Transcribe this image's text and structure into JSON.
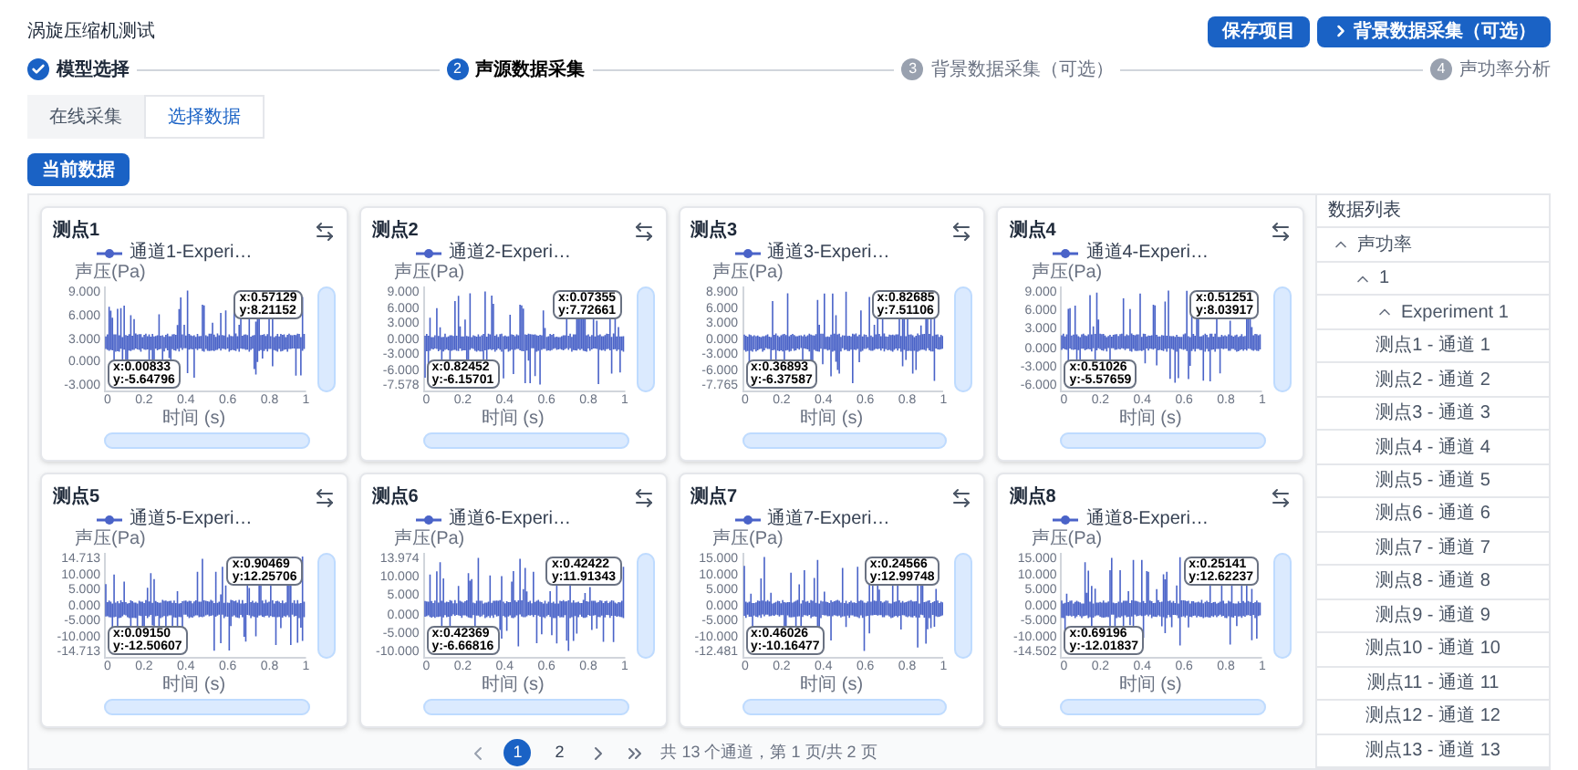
{
  "header": {
    "title": "涡旋压缩机测试",
    "buttons": [
      {
        "label": "保存项目",
        "kind": "plain"
      },
      {
        "label": "背景数据采集（可选）",
        "kind": "next"
      }
    ]
  },
  "steps": [
    {
      "label": "模型选择",
      "completed": true,
      "active": false
    },
    {
      "number": "2",
      "label": "声源数据采集",
      "completed": false,
      "active": true
    },
    {
      "number": "3",
      "label": "背景数据采集（可选）",
      "completed": false,
      "active": false
    },
    {
      "number": "4",
      "label": "声功率分析",
      "completed": false,
      "active": false
    }
  ],
  "zoom_sliders": {
    "vertical": {
      "level": 1
    },
    "horizontal": {
      "level": 1
    }
  },
  "tabs": [
    {
      "label": "在线采集",
      "selected": false
    },
    {
      "label": "选择数据",
      "selected": true
    }
  ],
  "current_data_button": "当前数据",
  "charts": [
    {
      "title": "测点1",
      "legend": "通道1-Experi…",
      "unit": "声压(Pa)",
      "y_ticks": [
        "9.000",
        "6.000",
        "3.000",
        "0.000",
        "-3.000"
      ],
      "x_ticks": [
        "0",
        "0.2",
        "0.4",
        "0.6",
        "0.8",
        "1"
      ],
      "x_label": "时间 (s)",
      "tooltips": [
        {
          "x": "x:0.57129",
          "y": "y:8.21152"
        },
        {
          "x": "x:0.00833",
          "y": "y:-5.64796"
        }
      ]
    },
    {
      "title": "测点2",
      "legend": "通道2-Experi…",
      "unit": "声压(Pa)",
      "y_ticks": [
        "9.000",
        "6.000",
        "3.000",
        "0.000",
        "-3.000",
        "-6.000",
        "-7.578"
      ],
      "x_ticks": [
        "0",
        "0.2",
        "0.4",
        "0.6",
        "0.8",
        "1"
      ],
      "x_label": "时间 (s)",
      "tooltips": [
        {
          "x": "x:0.07355",
          "y": "y:7.72661"
        },
        {
          "x": "x:0.82452",
          "y": "y:-6.15701"
        }
      ]
    },
    {
      "title": "测点3",
      "legend": "通道3-Experi…",
      "unit": "声压(Pa)",
      "y_ticks": [
        "8.900",
        "6.000",
        "3.000",
        "0.000",
        "-3.000",
        "-6.000",
        "-7.765"
      ],
      "x_ticks": [
        "0",
        "0.2",
        "0.4",
        "0.6",
        "0.8",
        "1"
      ],
      "x_label": "时间 (s)",
      "tooltips": [
        {
          "x": "x:0.82685",
          "y": "y:7.51106"
        },
        {
          "x": "x:0.36893",
          "y": "y:-6.37587"
        }
      ]
    },
    {
      "title": "测点4",
      "legend": "通道4-Experi…",
      "unit": "声压(Pa)",
      "y_ticks": [
        "9.000",
        "6.000",
        "3.000",
        "0.000",
        "-3.000",
        "-6.000"
      ],
      "x_ticks": [
        "0",
        "0.2",
        "0.4",
        "0.6",
        "0.8",
        "1"
      ],
      "x_label": "时间 (s)",
      "tooltips": [
        {
          "x": "x:0.51251",
          "y": "y:8.03917"
        },
        {
          "x": "x:0.51026",
          "y": "y:-5.57659"
        }
      ]
    },
    {
      "title": "测点5",
      "legend": "通道5-Experi…",
      "unit": "声压(Pa)",
      "y_ticks": [
        "14.713",
        "10.000",
        "5.000",
        "0.000",
        "-5.000",
        "-10.000",
        "-14.713"
      ],
      "x_ticks": [
        "0",
        "0.2",
        "0.4",
        "0.6",
        "0.8",
        "1"
      ],
      "x_label": "时间 (s)",
      "tooltips": [
        {
          "x": "x:0.90469",
          "y": "y:12.25706"
        },
        {
          "x": "x:0.09150",
          "y": "y:-12.50607"
        }
      ]
    },
    {
      "title": "测点6",
      "legend": "通道6-Experi…",
      "unit": "声压(Pa)",
      "y_ticks": [
        "13.974",
        "10.000",
        "5.000",
        "0.000",
        "-5.000",
        "-10.000"
      ],
      "x_ticks": [
        "0",
        "0.2",
        "0.4",
        "0.6",
        "0.8",
        "1"
      ],
      "x_label": "时间 (s)",
      "tooltips": [
        {
          "x": "x:0.42422",
          "y": "y:11.91343"
        },
        {
          "x": "x:0.42369",
          "y": "y:-6.66816"
        }
      ]
    },
    {
      "title": "测点7",
      "legend": "通道7-Experi…",
      "unit": "声压(Pa)",
      "y_ticks": [
        "15.000",
        "10.000",
        "5.000",
        "0.000",
        "-5.000",
        "-10.000",
        "-12.481"
      ],
      "x_ticks": [
        "0",
        "0.2",
        "0.4",
        "0.6",
        "0.8",
        "1"
      ],
      "x_label": "时间 (s)",
      "tooltips": [
        {
          "x": "x:0.24566",
          "y": "y:12.99748"
        },
        {
          "x": "x:0.46026",
          "y": "y:-10.16477"
        }
      ]
    },
    {
      "title": "测点8",
      "legend": "通道8-Experi…",
      "unit": "声压(Pa)",
      "y_ticks": [
        "15.000",
        "10.000",
        "5.000",
        "0.000",
        "-5.000",
        "-10.000",
        "-14.502"
      ],
      "x_ticks": [
        "0",
        "0.2",
        "0.4",
        "0.6",
        "0.8",
        "1"
      ],
      "x_label": "时间 (s)",
      "tooltips": [
        {
          "x": "x:0.25141",
          "y": "y:12.62237"
        },
        {
          "x": "x:0.69196",
          "y": "y:-12.01837"
        }
      ]
    }
  ],
  "data_list": {
    "title": "数据列表",
    "tree": [
      {
        "label": "声功率",
        "expanded": true,
        "children": [
          {
            "label": "1",
            "expanded": true,
            "children": [
              {
                "label": "Experiment 1",
                "expanded": true,
                "children": [
                  {
                    "label": "测点1 - 通道 1"
                  },
                  {
                    "label": "测点2 - 通道 2"
                  },
                  {
                    "label": "测点3 - 通道 3"
                  },
                  {
                    "label": "测点4 - 通道 4"
                  },
                  {
                    "label": "测点5 - 通道 5"
                  },
                  {
                    "label": "测点6 - 通道 6"
                  },
                  {
                    "label": "测点7 - 通道 7"
                  },
                  {
                    "label": "测点8 - 通道 8"
                  },
                  {
                    "label": "测点9 - 通道 9"
                  },
                  {
                    "label": "测点10 - 通道 10"
                  },
                  {
                    "label": "测点11 - 通道 11"
                  },
                  {
                    "label": "测点12 - 通道 12"
                  },
                  {
                    "label": "测点13 - 通道 13"
                  }
                ]
              }
            ]
          }
        ]
      }
    ]
  },
  "pagination": {
    "pages": [
      {
        "label": "1",
        "selected": true
      },
      {
        "label": "2",
        "selected": false
      }
    ],
    "summary": "共 13 个通道，第 1 页/共 2 页"
  }
}
